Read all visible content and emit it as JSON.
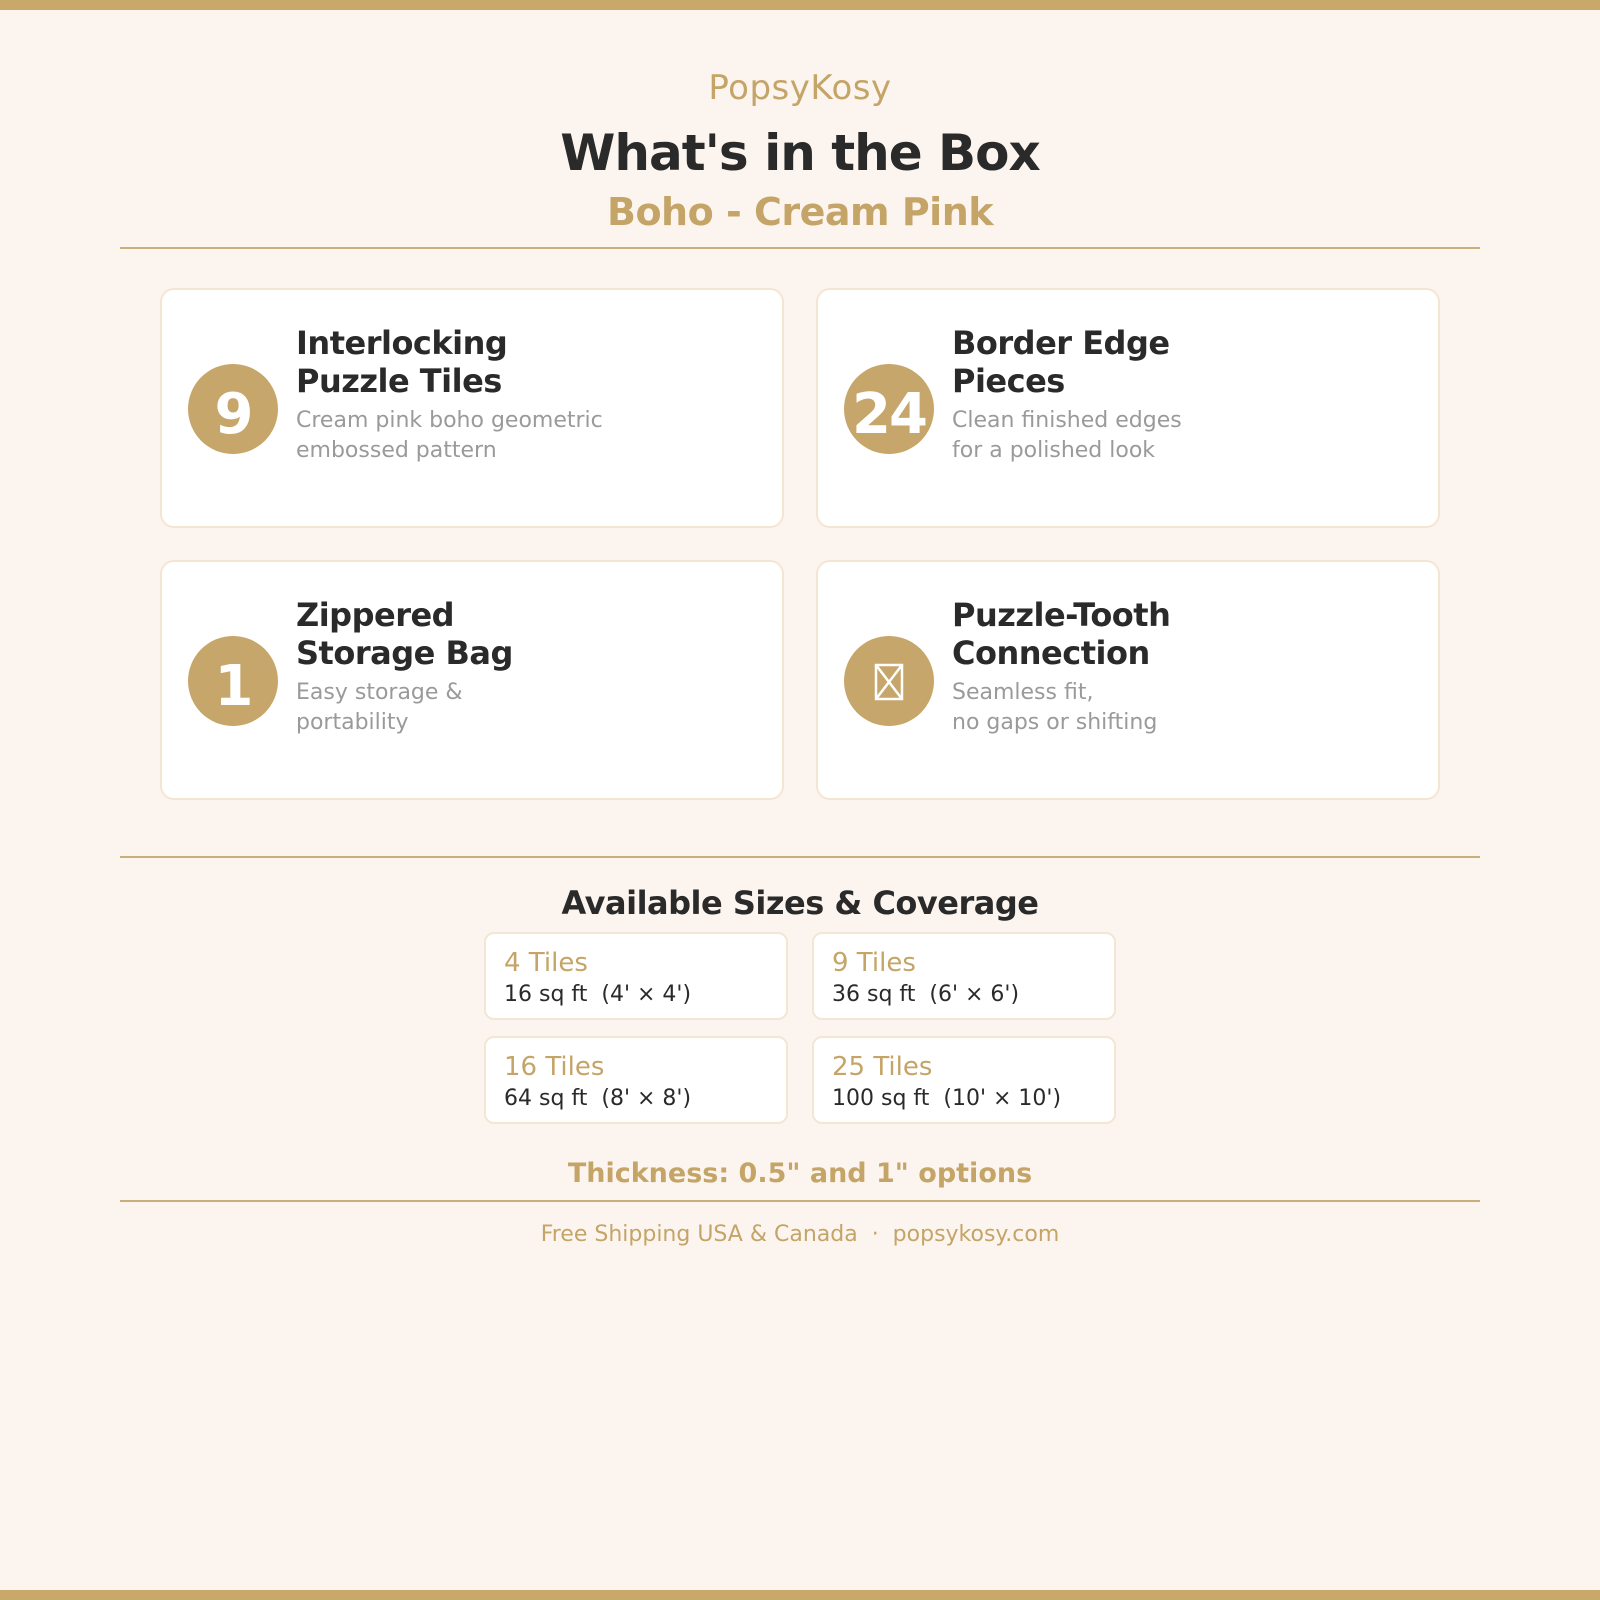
{
  "header": {
    "brand": "PopsyKosy",
    "title": "What's in the Box",
    "subtitle": "Boho - Cream Pink"
  },
  "items": [
    {
      "badge": "9",
      "title": "Interlocking\nPuzzle Tiles",
      "description": "Cream pink boho geometric\nembossed pattern"
    },
    {
      "badge": "24",
      "title": "Border Edge\nPieces",
      "description": "Clean finished edges\nfor a polished look"
    },
    {
      "badge": "1",
      "title": "Zippered\nStorage Bag",
      "description": "Easy storage &\nportability"
    },
    {
      "badge_icon": "puzzle-tooth-icon",
      "title": "Puzzle-Tooth\nConnection",
      "description": "Seamless fit,\nno gaps or shifting"
    }
  ],
  "sizes": {
    "title": "Available Sizes & Coverage",
    "options": [
      {
        "tiles": "4 Tiles",
        "coverage": "16 sq ft  (4' × 4')"
      },
      {
        "tiles": "9 Tiles",
        "coverage": "36 sq ft  (6' × 6')"
      },
      {
        "tiles": "16 Tiles",
        "coverage": "64 sq ft  (8' × 8')"
      },
      {
        "tiles": "25 Tiles",
        "coverage": "100 sq ft  (10' × 10')"
      }
    ]
  },
  "thickness": "Thickness: 0.5\" and 1\" options",
  "footer": "Free Shipping USA & Canada  ·  popsykosy.com",
  "colors": {
    "background": "#fcf5ef",
    "accent": "#c6a66a",
    "text": "#2a2a2a",
    "muted": "#9a9a9a"
  }
}
